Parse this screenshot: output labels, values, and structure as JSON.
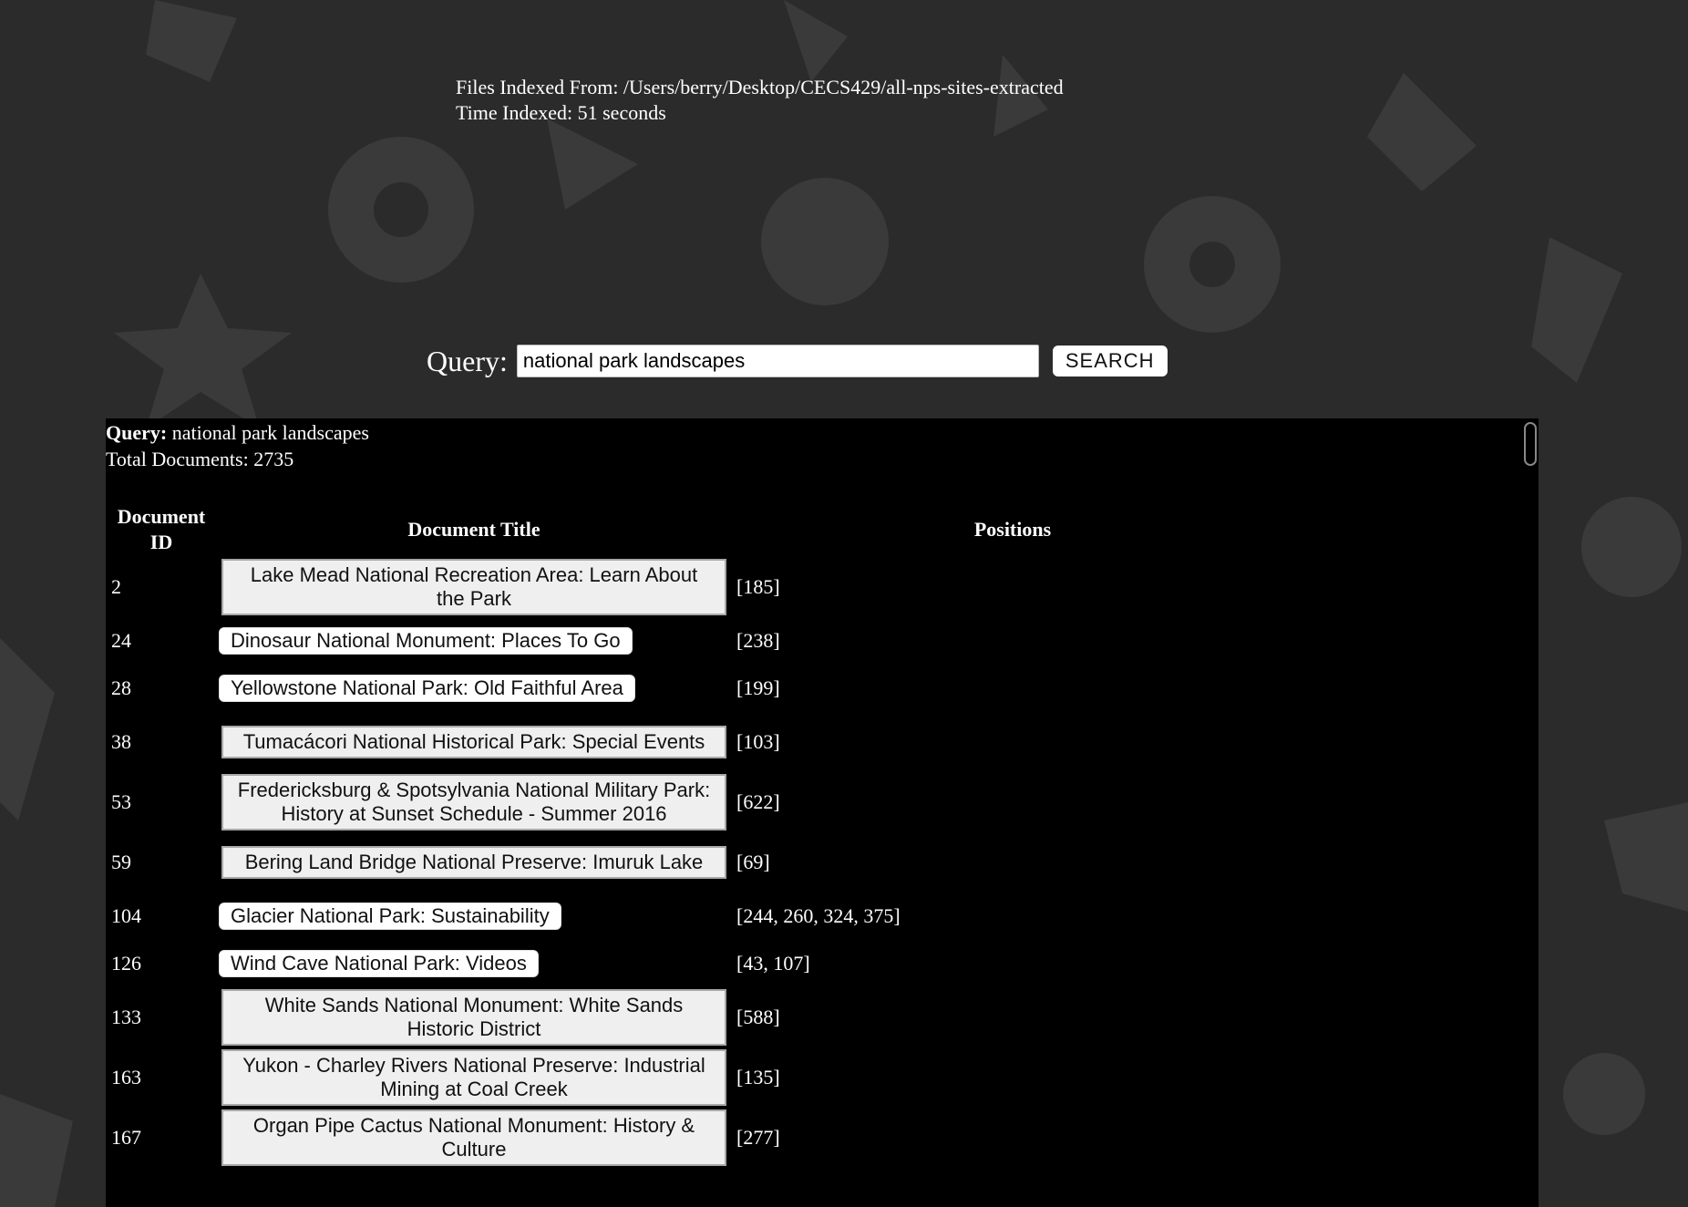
{
  "index_info": {
    "files_indexed_from": "Files Indexed From: /Users/berry/Desktop/CECS429/all-nps-sites-extracted",
    "time_indexed": "Time Indexed: 51 seconds"
  },
  "search": {
    "label": "Query:",
    "value": "national park landscapes",
    "button_label": "SEARCH"
  },
  "results": {
    "query_label": "Query:",
    "query_value": "national park landscapes",
    "total_documents": "Total Documents: 2735",
    "headers": {
      "doc_id_line1": "Document",
      "doc_id_line2": "ID",
      "title": "Document Title",
      "positions": "Positions"
    },
    "rows": [
      {
        "id": "2",
        "title": "Lake Mead National Recreation Area: Learn About the Park",
        "positions": "[185]",
        "style": "wide"
      },
      {
        "id": "24",
        "title": "Dinosaur National Monument: Places To Go",
        "positions": "[238]",
        "style": "pill"
      },
      {
        "id": "28",
        "title": "Yellowstone National Park: Old Faithful Area",
        "positions": "[199]",
        "style": "pill"
      },
      {
        "id": "38",
        "title": "Tumacácori National Historical Park: Special Events",
        "positions": "[103]",
        "style": "wide"
      },
      {
        "id": "53",
        "title": "Fredericksburg & Spotsylvania National Military Park: History at Sunset Schedule - Summer 2016",
        "positions": "[622]",
        "style": "wide"
      },
      {
        "id": "59",
        "title": "Bering Land Bridge National Preserve: Imuruk Lake",
        "positions": "[69]",
        "style": "wide"
      },
      {
        "id": "104",
        "title": "Glacier National Park: Sustainability",
        "positions": "[244, 260, 324, 375]",
        "style": "pill"
      },
      {
        "id": "126",
        "title": "Wind Cave National Park: Videos",
        "positions": "[43, 107]",
        "style": "pill"
      },
      {
        "id": "133",
        "title": "White Sands National Monument: White Sands Historic District",
        "positions": "[588]",
        "style": "wide"
      },
      {
        "id": "163",
        "title": "Yukon - Charley Rivers National Preserve: Industrial Mining at Coal Creek",
        "positions": "[135]",
        "style": "wide"
      },
      {
        "id": "167",
        "title": "Organ Pipe Cactus National Monument: History & Culture",
        "positions": "[277]",
        "style": "wide"
      }
    ]
  }
}
